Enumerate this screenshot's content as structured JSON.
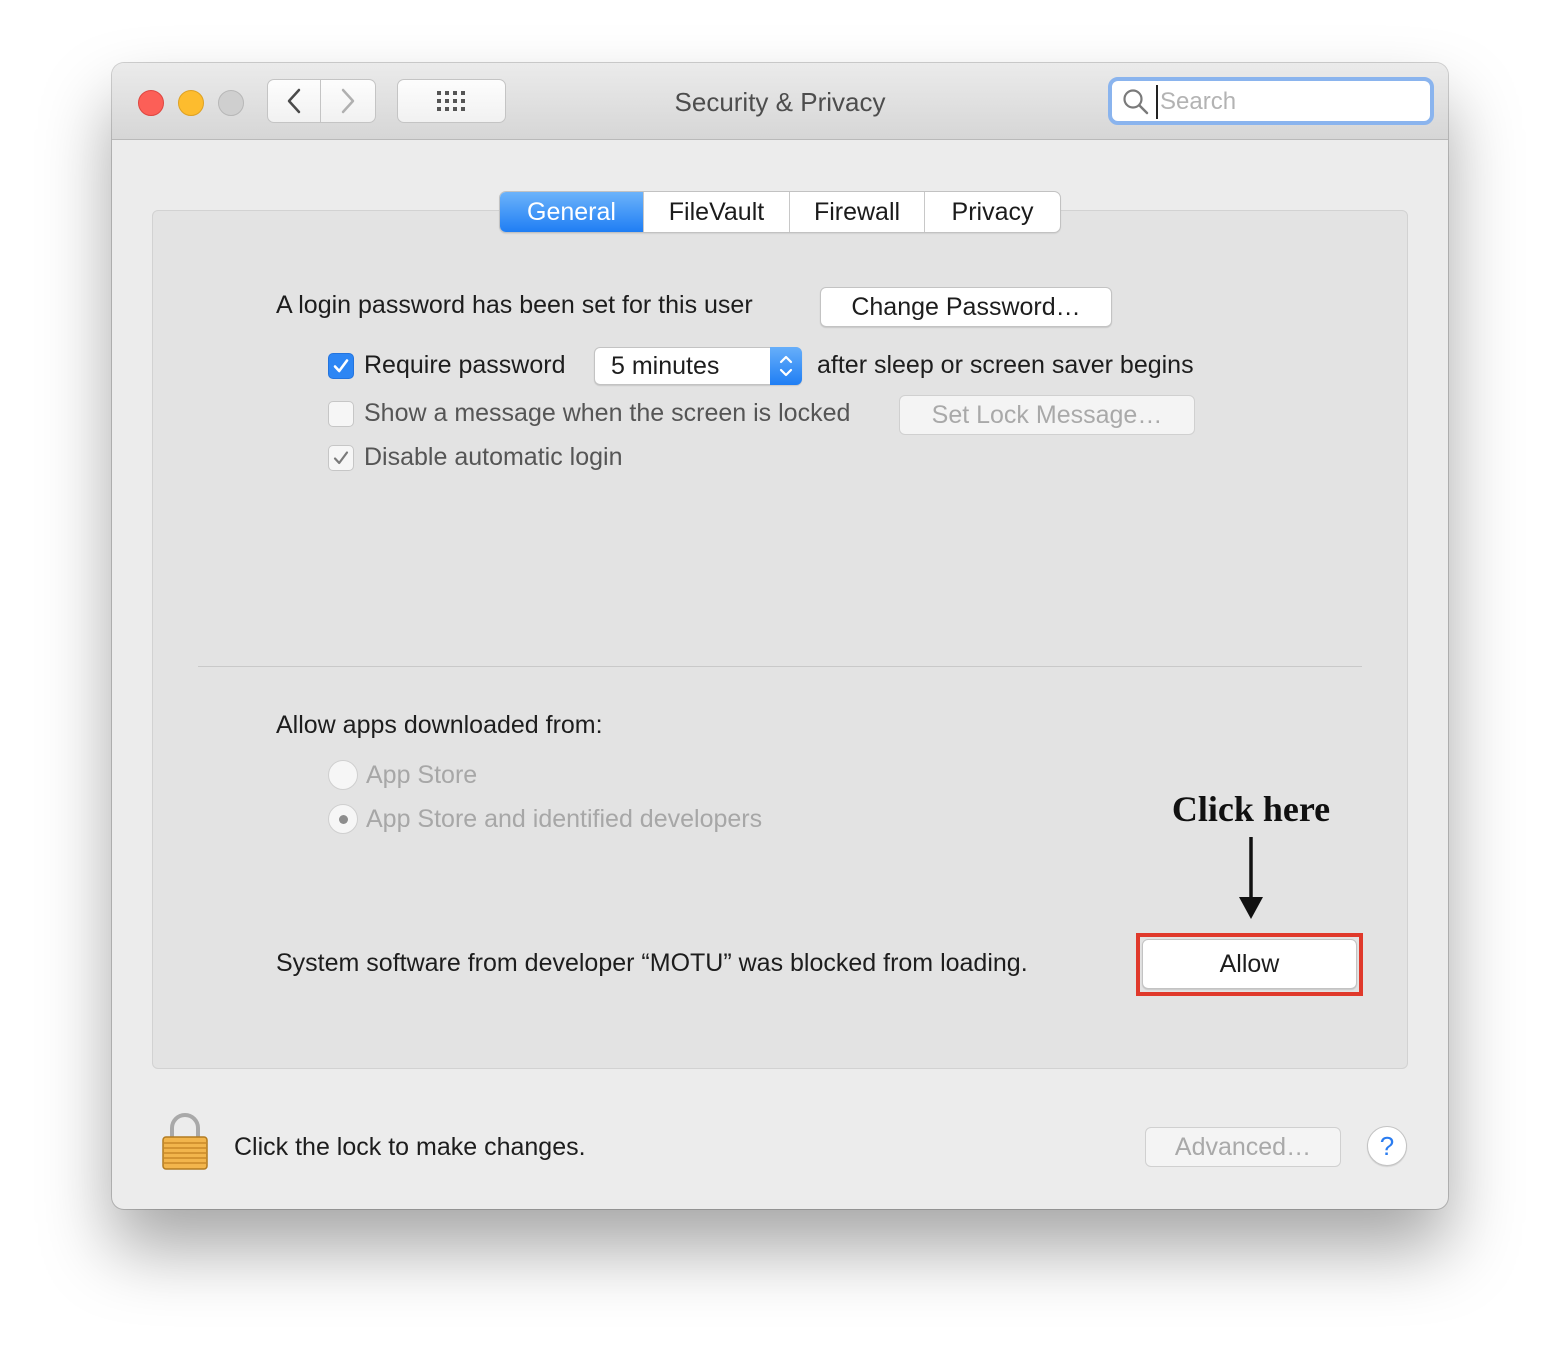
{
  "window": {
    "title": "Security & Privacy",
    "search": {
      "placeholder": "Search",
      "value": ""
    }
  },
  "toolbar": {
    "back_icon": "chevron-left-icon",
    "forward_icon": "chevron-right-icon",
    "grid_icon": "show-all-grid-icon"
  },
  "tabs": [
    {
      "label": "General",
      "active": true
    },
    {
      "label": "FileVault",
      "active": false
    },
    {
      "label": "Firewall",
      "active": false
    },
    {
      "label": "Privacy",
      "active": false
    }
  ],
  "general": {
    "login_password_text": "A login password has been set for this user",
    "change_password_label": "Change Password…",
    "require_password": {
      "label": "Require password",
      "checked": true,
      "delay_value": "5 minutes",
      "suffix": "after sleep or screen saver begins"
    },
    "show_message": {
      "label": "Show a message when the screen is locked",
      "checked": false,
      "button_label": "Set Lock Message…"
    },
    "disable_auto_login": {
      "label": "Disable automatic login",
      "checked": true
    },
    "allow_apps": {
      "heading": "Allow apps downloaded from:",
      "options": [
        {
          "label": "App Store",
          "selected": false
        },
        {
          "label": "App Store and identified developers",
          "selected": true
        }
      ]
    },
    "blocked_message": "System software from developer “MOTU” was blocked from loading.",
    "allow_label": "Allow"
  },
  "annotation": {
    "text": "Click here",
    "highlight_color": "#e0392b"
  },
  "footer": {
    "lock_text": "Click the lock to make changes.",
    "advanced_label": "Advanced…",
    "help_label": "?"
  },
  "colors": {
    "accent": "#1f7ef4",
    "close": "#fc5f57",
    "minimize": "#fdbc2e",
    "zoom_disabled": "#cfcfcf"
  }
}
